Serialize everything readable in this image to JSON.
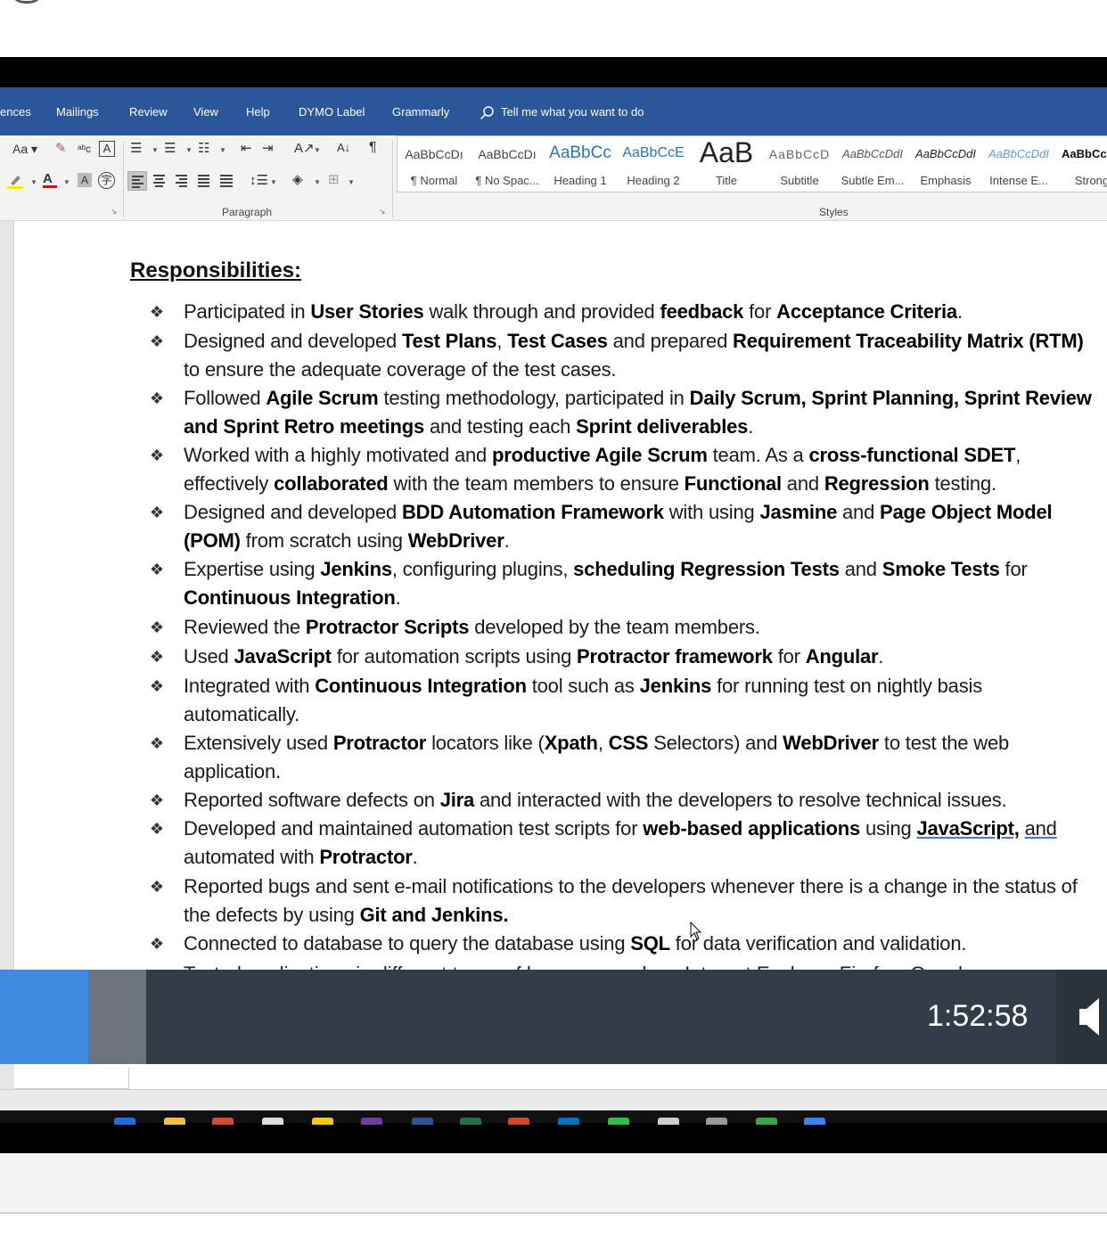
{
  "ribbon_tabs": [
    "ences",
    "Mailings",
    "Review",
    "View",
    "Help",
    "DYMO Label",
    "Grammarly"
  ],
  "tell_me": "Tell me what you want to do",
  "paragraph_group": "Paragraph",
  "styles_group": "Styles",
  "styles": [
    {
      "sample": "AaBbCcDı",
      "name": "¶ Normal"
    },
    {
      "sample": "AaBbCcDı",
      "name": "¶ No Spac..."
    },
    {
      "sample": "AaBbCc",
      "name": "Heading 1"
    },
    {
      "sample": "AaBbCcE",
      "name": "Heading 2"
    },
    {
      "sample": "AaB",
      "name": "Title"
    },
    {
      "sample": "AaBbCcD",
      "name": "Subtitle"
    },
    {
      "sample": "AaBbCcDdI",
      "name": "Subtle Em..."
    },
    {
      "sample": "AaBbCcDdI",
      "name": "Emphasis"
    },
    {
      "sample": "AaBbCcDdI",
      "name": "Intense E..."
    },
    {
      "sample": "AaBbCcDd",
      "name": "Strong"
    }
  ],
  "font_size_label": "Aa",
  "document": {
    "heading": "Responsibilities:",
    "cutoff_line": "Tested applications in different types of browsers such as Internet Explorer, Firefox, Google"
  },
  "bullets": [
    [
      [
        "Participated in ",
        0
      ],
      [
        "User Stories",
        1
      ],
      [
        " walk through and provided ",
        0
      ],
      [
        "feedback",
        1
      ],
      [
        " for ",
        0
      ],
      [
        "Acceptance Criteria",
        1
      ],
      [
        ".",
        0
      ]
    ],
    [
      [
        "Designed and developed ",
        0
      ],
      [
        "Test Plans",
        1
      ],
      [
        ", ",
        0
      ],
      [
        "Test Cases",
        1
      ],
      [
        " and prepared ",
        0
      ],
      [
        "Requirement Traceability Matrix (RTM)",
        1
      ],
      [
        " to ensure the adequate coverage of the test cases.",
        0
      ]
    ],
    [
      [
        "Followed ",
        0
      ],
      [
        "Agile Scrum",
        1
      ],
      [
        " testing methodology, participated in ",
        0
      ],
      [
        "Daily Scrum, Sprint Planning, Sprint Review and Sprint Retro meetings",
        1
      ],
      [
        " and testing each ",
        0
      ],
      [
        "Sprint deliverables",
        1
      ],
      [
        ".",
        0
      ]
    ],
    [
      [
        "Worked with a highly motivated and ",
        0
      ],
      [
        "productive Agile Scrum",
        1
      ],
      [
        " team. As a ",
        0
      ],
      [
        "cross-functional SDET",
        1
      ],
      [
        ", effectively ",
        0
      ],
      [
        "collaborated",
        1
      ],
      [
        " with the team members to ensure ",
        0
      ],
      [
        "Functional",
        1
      ],
      [
        " and ",
        0
      ],
      [
        "Regression",
        1
      ],
      [
        " testing.",
        0
      ]
    ],
    [
      [
        "Designed and developed ",
        0
      ],
      [
        "BDD Automation Framework",
        1
      ],
      [
        " with using ",
        0
      ],
      [
        "Jasmine",
        1
      ],
      [
        " and ",
        0
      ],
      [
        "Page Object Model (POM)",
        1
      ],
      [
        " from scratch using ",
        0
      ],
      [
        "WebDriver",
        1
      ],
      [
        ".",
        0
      ]
    ],
    [
      [
        "Expertise using ",
        0
      ],
      [
        "Jenkins",
        1
      ],
      [
        ", configuring plugins, ",
        0
      ],
      [
        "scheduling Regression Tests",
        1
      ],
      [
        " and ",
        0
      ],
      [
        "Smoke Tests",
        1
      ],
      [
        " for ",
        0
      ],
      [
        "Continuous Integration",
        1
      ],
      [
        ".",
        0
      ]
    ],
    [
      [
        "Reviewed the ",
        0
      ],
      [
        "Protractor Scripts",
        1
      ],
      [
        " developed by the team members.",
        0
      ]
    ],
    [
      [
        "Used ",
        0
      ],
      [
        "JavaScript",
        1
      ],
      [
        " for automation scripts using ",
        0
      ],
      [
        "Protractor framework",
        1
      ],
      [
        " for ",
        0
      ],
      [
        "Angular",
        1
      ],
      [
        ".",
        0
      ]
    ],
    [
      [
        "Integrated with ",
        0
      ],
      [
        "Continuous Integration",
        1
      ],
      [
        " tool such as ",
        0
      ],
      [
        "Jenkins",
        1
      ],
      [
        " for running test on nightly basis automatically.",
        0
      ]
    ],
    [
      [
        "Extensively used ",
        0
      ],
      [
        "Protractor",
        1
      ],
      [
        " locators like (",
        0
      ],
      [
        "Xpath",
        1
      ],
      [
        ", ",
        0
      ],
      [
        "CSS",
        1
      ],
      [
        " Selectors) and ",
        0
      ],
      [
        "WebDriver",
        1
      ],
      [
        " to test the web application.",
        0
      ]
    ],
    [
      [
        "Reported software defects on ",
        0
      ],
      [
        "Jira",
        1
      ],
      [
        " and interacted with the developers to resolve technical issues.",
        0
      ]
    ],
    [
      [
        "Developed and maintained automation test scripts for ",
        0
      ],
      [
        "web-based applications",
        1
      ],
      [
        " using ",
        0
      ],
      [
        "JavaScript,",
        3
      ],
      [
        " ",
        0
      ],
      [
        "and",
        2
      ],
      [
        " automated with ",
        0
      ],
      [
        "Protractor",
        1
      ],
      [
        ".",
        0
      ]
    ],
    [
      [
        "Reported bugs and sent e-mail notifications to the developers whenever there is a change in the status of the defects by using ",
        0
      ],
      [
        "Git and Jenkins.",
        1
      ]
    ],
    [
      [
        "Connected to database to query the database using ",
        0
      ],
      [
        "SQL",
        1
      ],
      [
        " for data verification and validation.",
        0
      ]
    ]
  ],
  "player": {
    "time": "1:52:58",
    "progress_fraction": 0.08
  },
  "colors": {
    "ribbon_blue": "#2b579a",
    "progress_blue": "#3f8ae0",
    "player_bg": "#333d47"
  }
}
